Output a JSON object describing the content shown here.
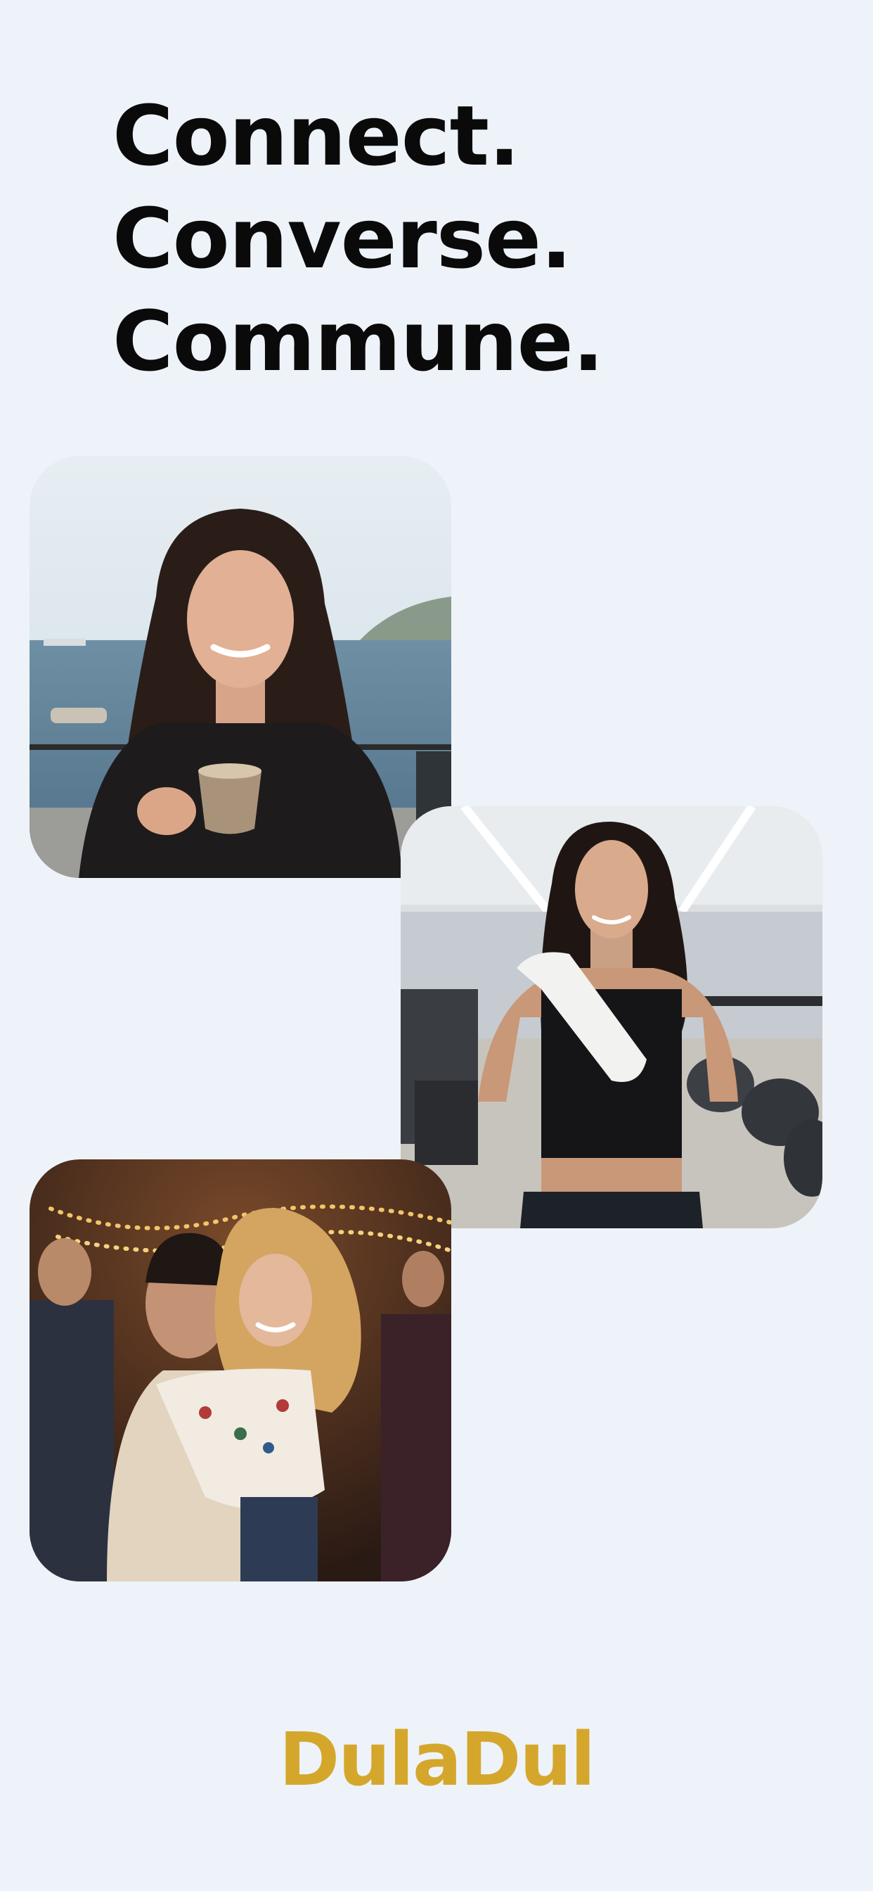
{
  "headline": {
    "line1": "Connect.",
    "line2": "Converse.",
    "line3": "Commune."
  },
  "photos": [
    {
      "name": "woman-with-coffee-by-harbor-photo"
    },
    {
      "name": "woman-at-gym-with-towel-photo"
    },
    {
      "name": "couple-dancing-at-party-photo"
    }
  ],
  "brand": {
    "name": "DulaDul",
    "color": "#d4a72c"
  },
  "colors": {
    "background": "#eef3f9",
    "headline": "#0a0a0a"
  }
}
